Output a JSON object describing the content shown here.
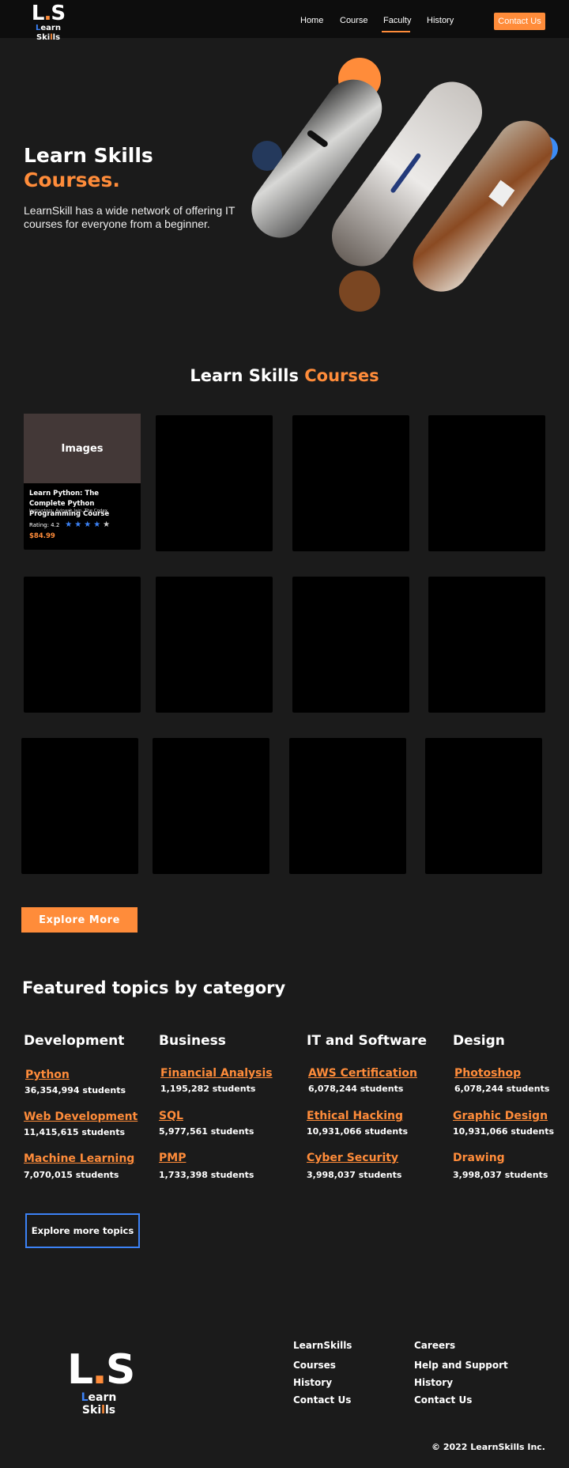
{
  "brand": {
    "logo_mark": "L.S",
    "logo_text_prefix": "L",
    "logo_text_middle": "earn Ski",
    "logo_text_suffix": "lls"
  },
  "nav": {
    "links": [
      "Home",
      "Course",
      "Faculty",
      "History"
    ],
    "active": "Faculty",
    "contact_label": "Contact Us"
  },
  "hero": {
    "title_line1": "Learn Skills",
    "title_line2": "Courses.",
    "description": "LearnSkill has a wide network of offering IT courses for everyone from a beginner."
  },
  "courses": {
    "title_white": "Learn Skills ",
    "title_orange": "Courses",
    "featured_card": {
      "image_label": "Images",
      "title": "Learn Python: The Complete Python Programming Course",
      "instructors": "Instructors: Avinash Jain, The Codex",
      "rating_label": "Rating: 4.2",
      "rating": 4.2,
      "stars_filled": 4,
      "stars_total": 5,
      "price": "$84.99"
    },
    "explore_label": "Explore More"
  },
  "topics": {
    "title": "Featured topics by category",
    "categories": [
      {
        "name": "Development",
        "items": [
          {
            "topic": "Python",
            "students": "36,354,994 students"
          },
          {
            "topic": "Web Development",
            "students": "11,415,615 students"
          },
          {
            "topic": "Machine Learning",
            "students": "7,070,015 students"
          }
        ]
      },
      {
        "name": "Business",
        "items": [
          {
            "topic": "Financial Analysis",
            "students": "1,195,282 students"
          },
          {
            "topic": "SQL",
            "students": "5,977,561 students"
          },
          {
            "topic": "PMP",
            "students": "1,733,398 students"
          }
        ]
      },
      {
        "name": "IT and Software",
        "items": [
          {
            "topic": "AWS Certification",
            "students": "6,078,244 students"
          },
          {
            "topic": "Ethical Hacking",
            "students": "10,931,066 students"
          },
          {
            "topic": "Cyber Security",
            "students": "3,998,037 students"
          }
        ]
      },
      {
        "name": "Design",
        "items": [
          {
            "topic": "Photoshop",
            "students": "6,078,244 students"
          },
          {
            "topic": "Graphic Design",
            "students": "10,931,066 students"
          },
          {
            "topic": "Drawing",
            "students": "3,998,037 students"
          }
        ]
      }
    ],
    "more_label": "Explore more topics"
  },
  "footer": {
    "col1": {
      "head": "LearnSkills",
      "links": [
        "Courses",
        "History",
        "Contact Us"
      ]
    },
    "col2": {
      "head": "Careers",
      "links": [
        "Help and Support",
        "History",
        "Contact Us"
      ]
    },
    "copyright": "© 2022 LearnSkills Inc."
  },
  "colors": {
    "accent": "#ff8c3a",
    "blue": "#3c82f6",
    "background": "#1b1b1b",
    "nav": "#0d0d0d",
    "card": "#000000"
  }
}
